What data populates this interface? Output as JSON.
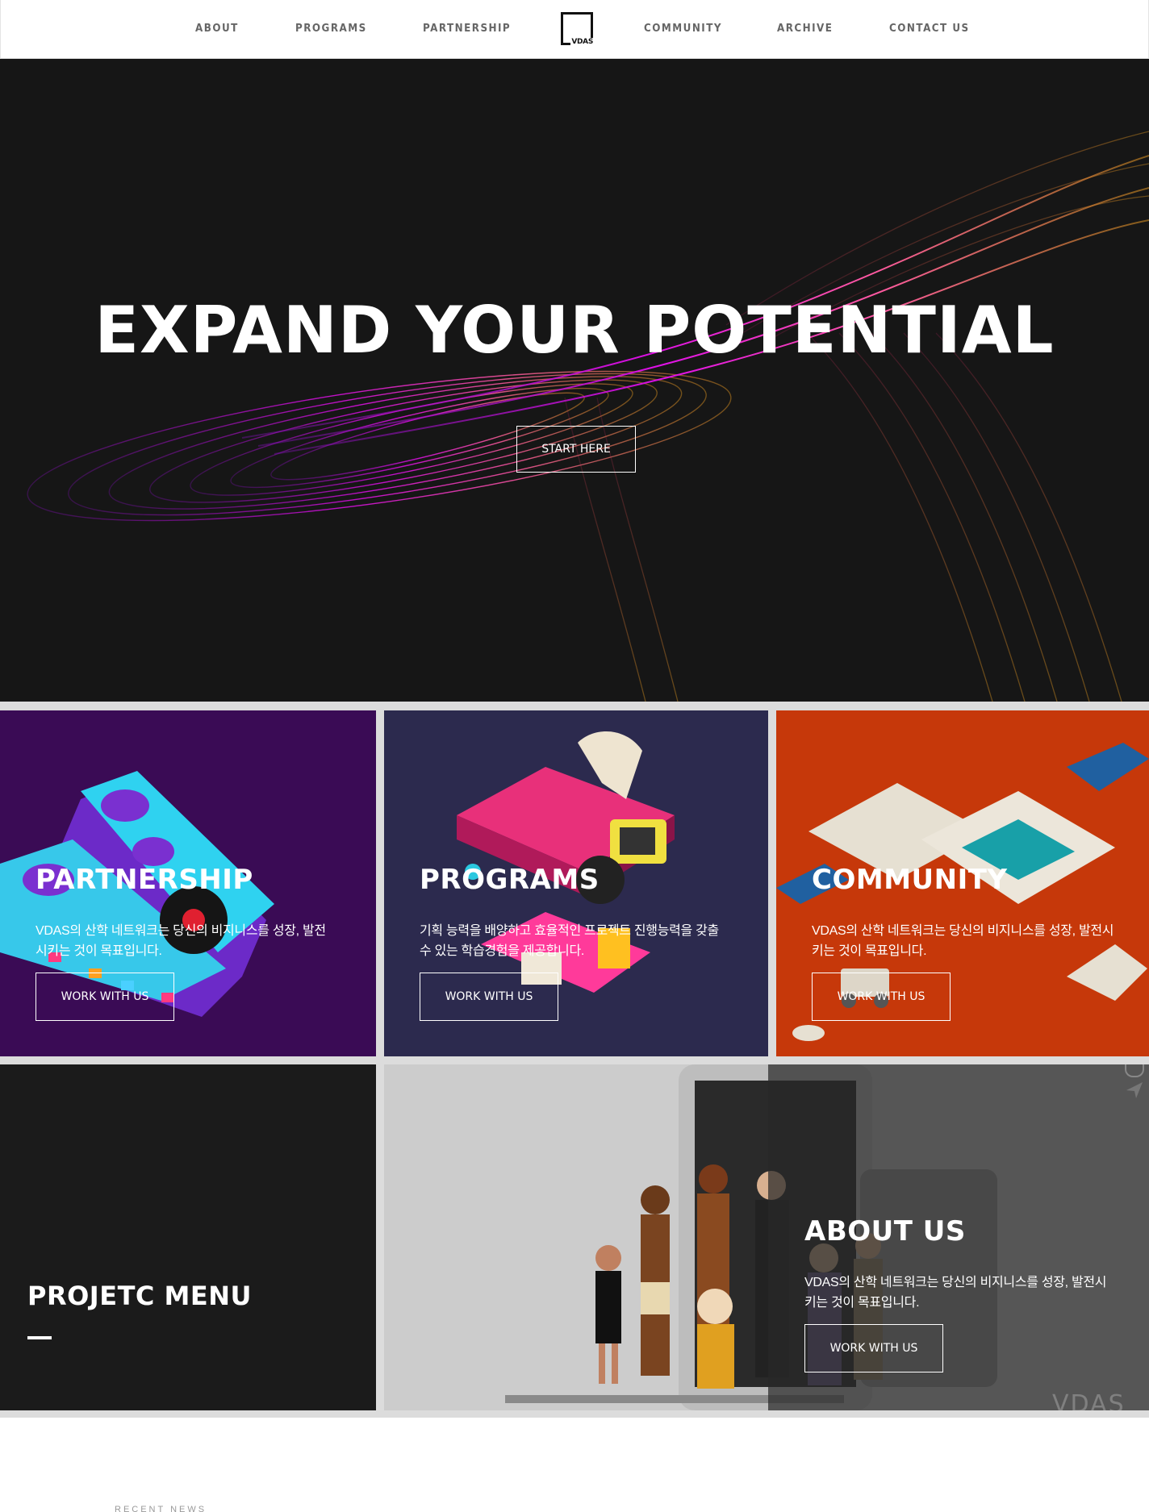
{
  "nav": {
    "items": [
      {
        "label": "ABOUT"
      },
      {
        "label": "PROGRAMS"
      },
      {
        "label": "PARTNERSHIP"
      },
      {
        "label": "COMMUNITY"
      },
      {
        "label": "ARCHIVE"
      },
      {
        "label": "CONTACT US"
      }
    ],
    "logo_text": "VDAS"
  },
  "hero": {
    "title": "EXPAND YOUR POTENTIAL",
    "button": "START HERE"
  },
  "tiles": {
    "partnership": {
      "title": "PARTNERSHIP",
      "text_line1": "VDAS의 산학 네트워크는 당신의 비지니스를 성장, 발전",
      "text_line2": "시키는 것이 목표입니다.",
      "button": "WORK WITH US",
      "bg": "#3a0b55"
    },
    "programs": {
      "title": "PROGRAMS",
      "text_line1": "기획 능력을 배양하고 효율적인 프로젝트 진행능력을 갖출",
      "text_line2": "수 있는 학습경험을 제공합니다.",
      "button": "WORK WITH US",
      "bg": "#2c2a4e"
    },
    "community": {
      "title": "COMMUNITY",
      "text_line1": "VDAS의 산학 네트워크는 당신의 비지니스를 성장, 발전시",
      "text_line2": "키는 것이 목표입니다.",
      "button": "WORK WITH US",
      "bg": "#c6380a"
    },
    "project_menu": {
      "title": "PROJETC MENU"
    },
    "about": {
      "title": "ABOUT US",
      "text_line1": "VDAS의 산학 네트워크는 당신의 비지니스를 성장, 발전시",
      "text_line2": "키는 것이 목표입니다.",
      "button": "WORK WITH US",
      "watermark": "VDAS"
    }
  },
  "footer": {
    "recent_news": "RECENT NEWS"
  },
  "colors": {
    "accent_magenta": "#e010e8",
    "hero_bg": "#161616",
    "gap": "#dcdcdc"
  }
}
